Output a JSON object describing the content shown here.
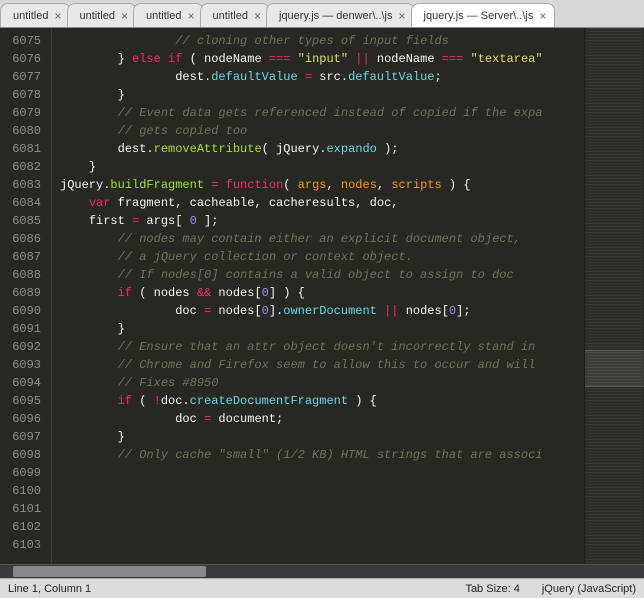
{
  "tabs": [
    {
      "label": "untitled",
      "active": false
    },
    {
      "label": "untitled",
      "active": false
    },
    {
      "label": "untitled",
      "active": false
    },
    {
      "label": "untitled",
      "active": false
    },
    {
      "label": "jquery.js — denwer\\..\\js",
      "active": false
    },
    {
      "label": "jquery.js — Server\\..\\js",
      "active": true
    }
  ],
  "gutter_start": 6075,
  "gutter_count": 29,
  "code_lines": [
    [
      [
        "c-comment",
        "    // cloning other types of input fields"
      ]
    ],
    [
      [
        "c-ident",
        "} "
      ],
      [
        "c-key",
        "else if"
      ],
      [
        "c-ident",
        " ( nodeName "
      ],
      [
        "c-op",
        "==="
      ],
      [
        "c-ident",
        " "
      ],
      [
        "c-str",
        "\"input\""
      ],
      [
        "c-ident",
        " "
      ],
      [
        "c-op",
        "||"
      ],
      [
        "c-ident",
        " nodeName "
      ],
      [
        "c-op",
        "==="
      ],
      [
        "c-ident",
        " "
      ],
      [
        "c-str",
        "\"textarea\""
      ]
    ],
    [
      [
        "c-ident",
        "    dest."
      ],
      [
        "c-member",
        "defaultValue"
      ],
      [
        "c-ident",
        " "
      ],
      [
        "c-op",
        "="
      ],
      [
        "c-ident",
        " src."
      ],
      [
        "c-member",
        "defaultValue"
      ],
      [
        "c-ident",
        ";"
      ]
    ],
    [
      [
        "c-ident",
        "}"
      ]
    ],
    [
      [
        "c-ident",
        ""
      ]
    ],
    [
      [
        "c-comment",
        "// Event data gets referenced instead of copied if the expa"
      ]
    ],
    [
      [
        "c-comment",
        "// gets copied too"
      ]
    ],
    [
      [
        "c-ident",
        "dest."
      ],
      [
        "c-fn",
        "removeAttribute"
      ],
      [
        "c-ident",
        "( jQuery."
      ],
      [
        "c-member",
        "expando"
      ],
      [
        "c-ident",
        " );"
      ]
    ],
    [
      [
        "c-ident",
        "}"
      ]
    ],
    [
      [
        "c-ident",
        ""
      ]
    ],
    [
      [
        "c-ident",
        "jQuery."
      ],
      [
        "c-fn",
        "buildFragment"
      ],
      [
        "c-ident",
        " "
      ],
      [
        "c-op",
        "="
      ],
      [
        "c-ident",
        " "
      ],
      [
        "c-key",
        "function"
      ],
      [
        "c-ident",
        "( "
      ],
      [
        "c-param",
        "args"
      ],
      [
        "c-ident",
        ", "
      ],
      [
        "c-param",
        "nodes"
      ],
      [
        "c-ident",
        ", "
      ],
      [
        "c-param",
        "scripts"
      ],
      [
        "c-ident",
        " ) {"
      ]
    ],
    [
      [
        "c-key",
        "var"
      ],
      [
        "c-ident",
        " fragment, cacheable, cacheresults, doc,"
      ]
    ],
    [
      [
        "c-ident",
        "first "
      ],
      [
        "c-op",
        "="
      ],
      [
        "c-ident",
        " args[ "
      ],
      [
        "c-num",
        "0"
      ],
      [
        "c-ident",
        " ];"
      ]
    ],
    [
      [
        "c-ident",
        ""
      ]
    ],
    [
      [
        "c-comment",
        "// nodes may contain either an explicit document object,"
      ]
    ],
    [
      [
        "c-comment",
        "// a jQuery collection or context object."
      ]
    ],
    [
      [
        "c-comment",
        "// If nodes[0] contains a valid object to assign to doc"
      ]
    ],
    [
      [
        "c-key",
        "if"
      ],
      [
        "c-ident",
        " ( nodes "
      ],
      [
        "c-op",
        "&&"
      ],
      [
        "c-ident",
        " nodes["
      ],
      [
        "c-num",
        "0"
      ],
      [
        "c-ident",
        "] ) {"
      ]
    ],
    [
      [
        "c-ident",
        "    doc "
      ],
      [
        "c-op",
        "="
      ],
      [
        "c-ident",
        " nodes["
      ],
      [
        "c-num",
        "0"
      ],
      [
        "c-ident",
        "]."
      ],
      [
        "c-member",
        "ownerDocument"
      ],
      [
        "c-ident",
        " "
      ],
      [
        "c-op",
        "||"
      ],
      [
        "c-ident",
        " nodes["
      ],
      [
        "c-num",
        "0"
      ],
      [
        "c-ident",
        "];"
      ]
    ],
    [
      [
        "c-ident",
        "}"
      ]
    ],
    [
      [
        "c-ident",
        ""
      ]
    ],
    [
      [
        "c-comment",
        "// Ensure that an attr object doesn't incorrectly stand in"
      ]
    ],
    [
      [
        "c-comment",
        "// Chrome and Firefox seem to allow this to occur and will"
      ]
    ],
    [
      [
        "c-comment",
        "// Fixes #8950"
      ]
    ],
    [
      [
        "c-key",
        "if"
      ],
      [
        "c-ident",
        " ( "
      ],
      [
        "c-op",
        "!"
      ],
      [
        "c-ident",
        "doc."
      ],
      [
        "c-member",
        "createDocumentFragment"
      ],
      [
        "c-ident",
        " ) {"
      ]
    ],
    [
      [
        "c-ident",
        "    doc "
      ],
      [
        "c-op",
        "="
      ],
      [
        "c-ident",
        " document;"
      ]
    ],
    [
      [
        "c-ident",
        "}"
      ]
    ],
    [
      [
        "c-ident",
        ""
      ]
    ],
    [
      [
        "c-comment",
        "// Only cache \"small\" (1/2 KB) HTML strings that are associ"
      ]
    ]
  ],
  "indent_levels": [
    3,
    2,
    3,
    2,
    0,
    2,
    2,
    2,
    1,
    0,
    0,
    1,
    1,
    0,
    2,
    2,
    2,
    2,
    3,
    2,
    0,
    2,
    2,
    2,
    2,
    3,
    2,
    0,
    2
  ],
  "close_glyph": "×",
  "minimap": {
    "viewport_top_pct": 60,
    "viewport_height_pct": 7
  },
  "hscroll": {
    "thumb_left_pct": 2,
    "thumb_width_pct": 30
  },
  "status": {
    "left": "Line 1, Column 1",
    "tabsize": "Tab Size: 4",
    "syntax": "jQuery (JavaScript)"
  }
}
